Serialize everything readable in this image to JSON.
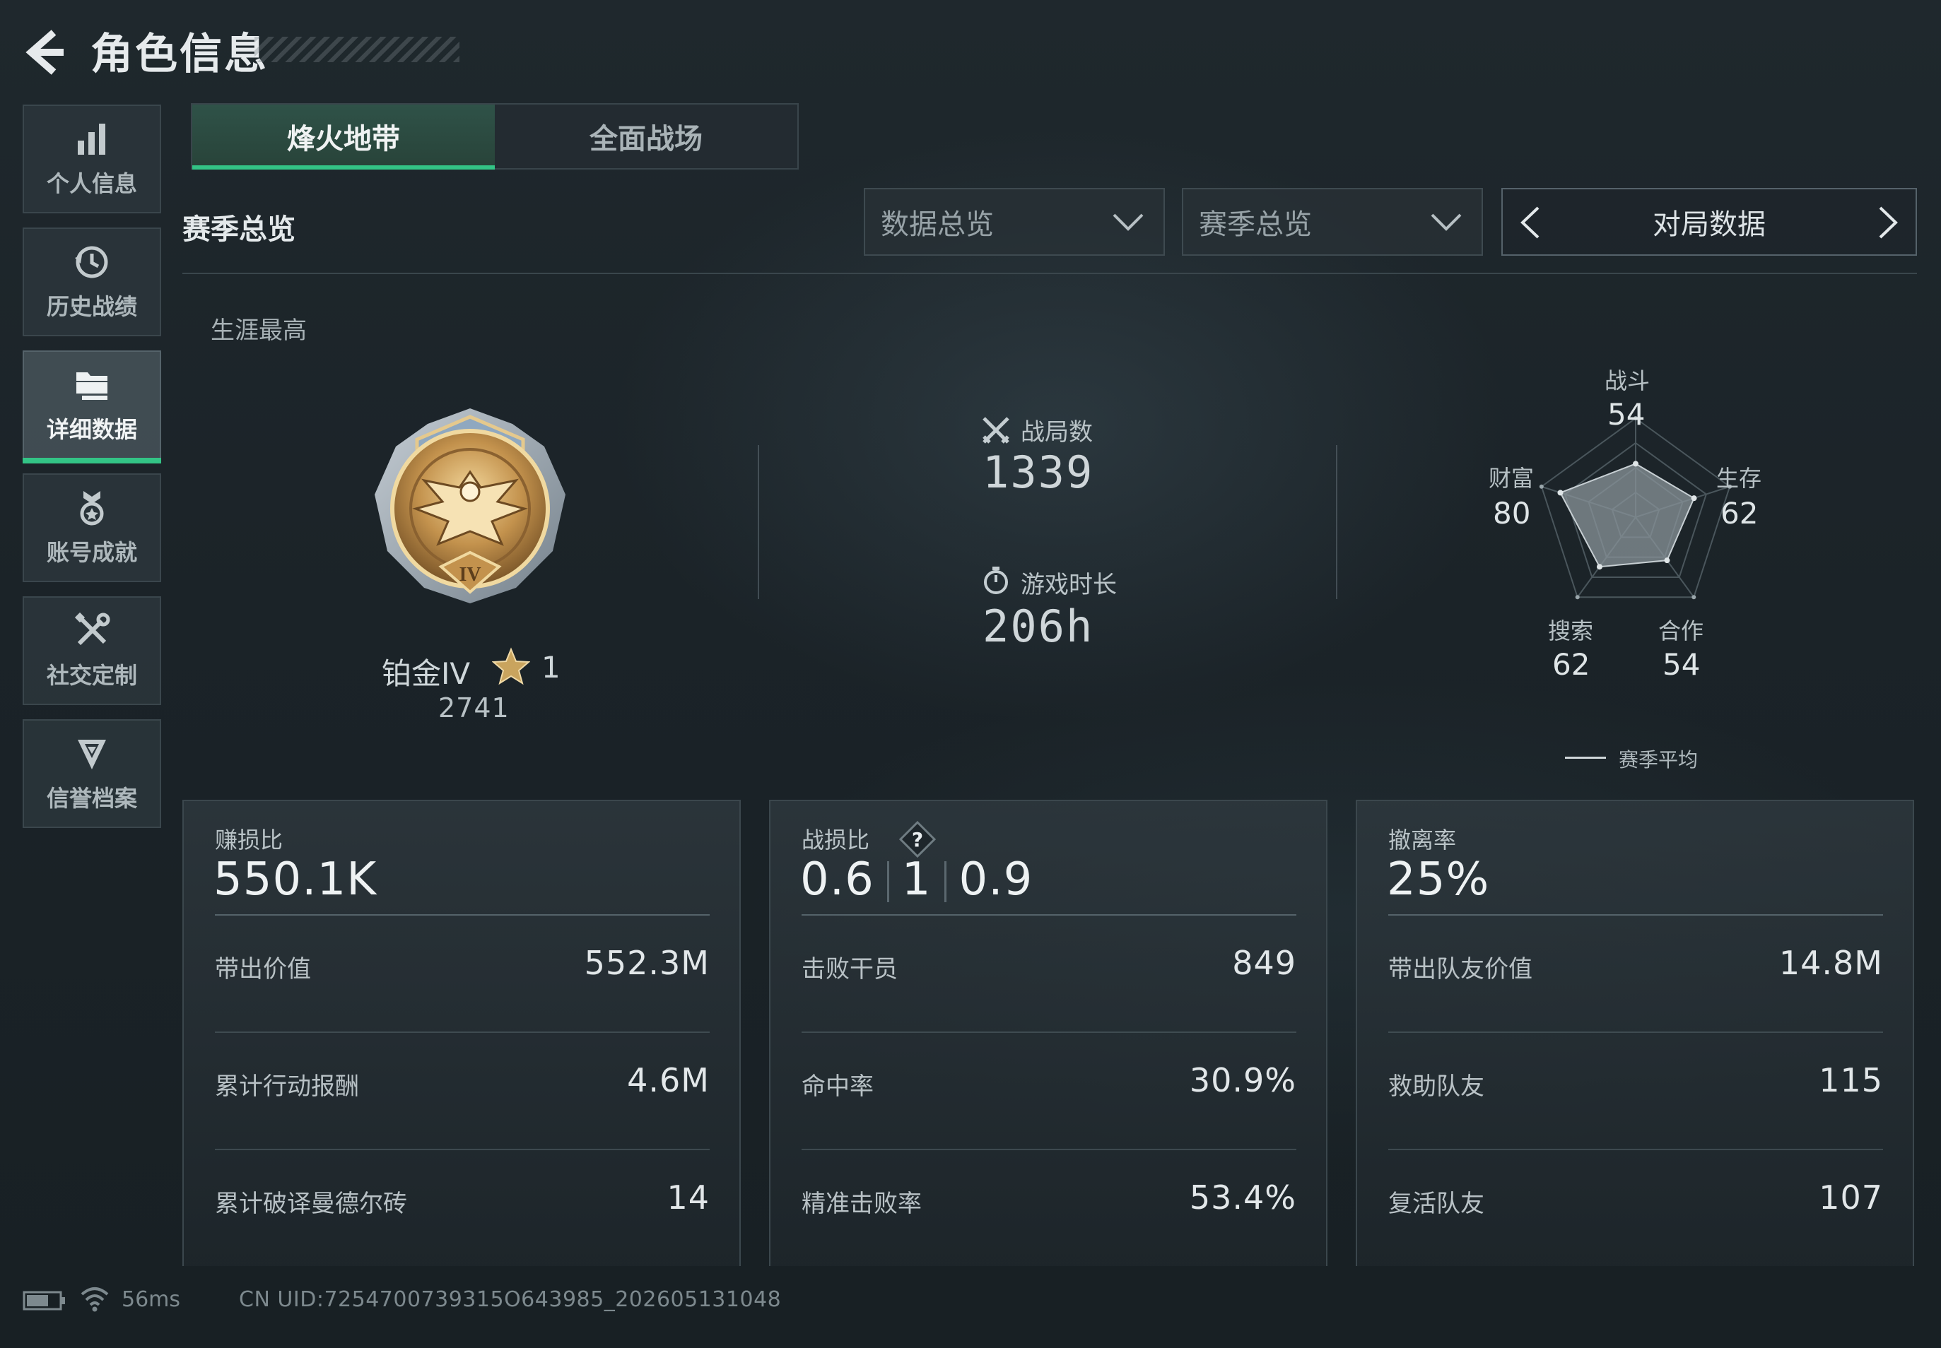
{
  "header": {
    "title": "角色信息"
  },
  "sidebar": {
    "items": [
      {
        "label": "个人信息",
        "icon": "bar-chart-icon",
        "active": false
      },
      {
        "label": "历史战绩",
        "icon": "clock-history-icon",
        "active": false
      },
      {
        "label": "详细数据",
        "icon": "folder-stack-icon",
        "active": true
      },
      {
        "label": "账号成就",
        "icon": "achievement-medal-icon",
        "active": false
      },
      {
        "label": "社交定制",
        "icon": "wrench-screwdriver-icon",
        "active": false
      },
      {
        "label": "信誉档案",
        "icon": "shield-chevron-icon",
        "active": false
      }
    ]
  },
  "tabs": [
    {
      "label": "烽火地带",
      "active": true
    },
    {
      "label": "全面战场",
      "active": false
    }
  ],
  "section": {
    "title": "赛季总览",
    "dropdown_data": "数据总览",
    "dropdown_season": "赛季总览",
    "pager_label": "对局数据"
  },
  "career": {
    "label": "生涯最高",
    "rank_name": "铂金IV",
    "rank_stars": "1",
    "rank_score": "2741"
  },
  "summary": {
    "matches_label": "战局数",
    "matches_value": "1339",
    "playtime_label": "游戏时长",
    "playtime_value": "206h"
  },
  "radar": {
    "axes": [
      {
        "label": "战斗",
        "value": "54"
      },
      {
        "label": "生存",
        "value": "62"
      },
      {
        "label": "合作",
        "value": "54"
      },
      {
        "label": "搜索",
        "value": "62"
      },
      {
        "label": "财富",
        "value": "80"
      }
    ],
    "scale_max": 100,
    "legend": "赛季平均"
  },
  "cards": [
    {
      "head_label": "赚损比",
      "head_value": "550.1K",
      "rows": [
        {
          "k": "带出价值",
          "v": "552.3M"
        },
        {
          "k": "累计行动报酬",
          "v": "4.6M"
        },
        {
          "k": "累计破译曼德尔砖",
          "v": "14"
        }
      ]
    },
    {
      "head_label": "战损比",
      "kd": [
        "0.6",
        "1",
        "0.9"
      ],
      "help": "?",
      "rows": [
        {
          "k": "击败干员",
          "v": "849"
        },
        {
          "k": "命中率",
          "v": "30.9%"
        },
        {
          "k": "精准击败率",
          "v": "53.4%"
        }
      ]
    },
    {
      "head_label": "撤离率",
      "head_value": "25%",
      "rows": [
        {
          "k": "带出队友价值",
          "v": "14.8M"
        },
        {
          "k": "救助队友",
          "v": "115"
        },
        {
          "k": "复活队友",
          "v": "107"
        }
      ]
    }
  ],
  "footer": {
    "ping": "56ms",
    "uid": "CN UID:7254700739315O643985_202605131048"
  },
  "colors": {
    "accent": "#33c486",
    "background": "#1b2328",
    "radar_fill": "#8a9499"
  }
}
